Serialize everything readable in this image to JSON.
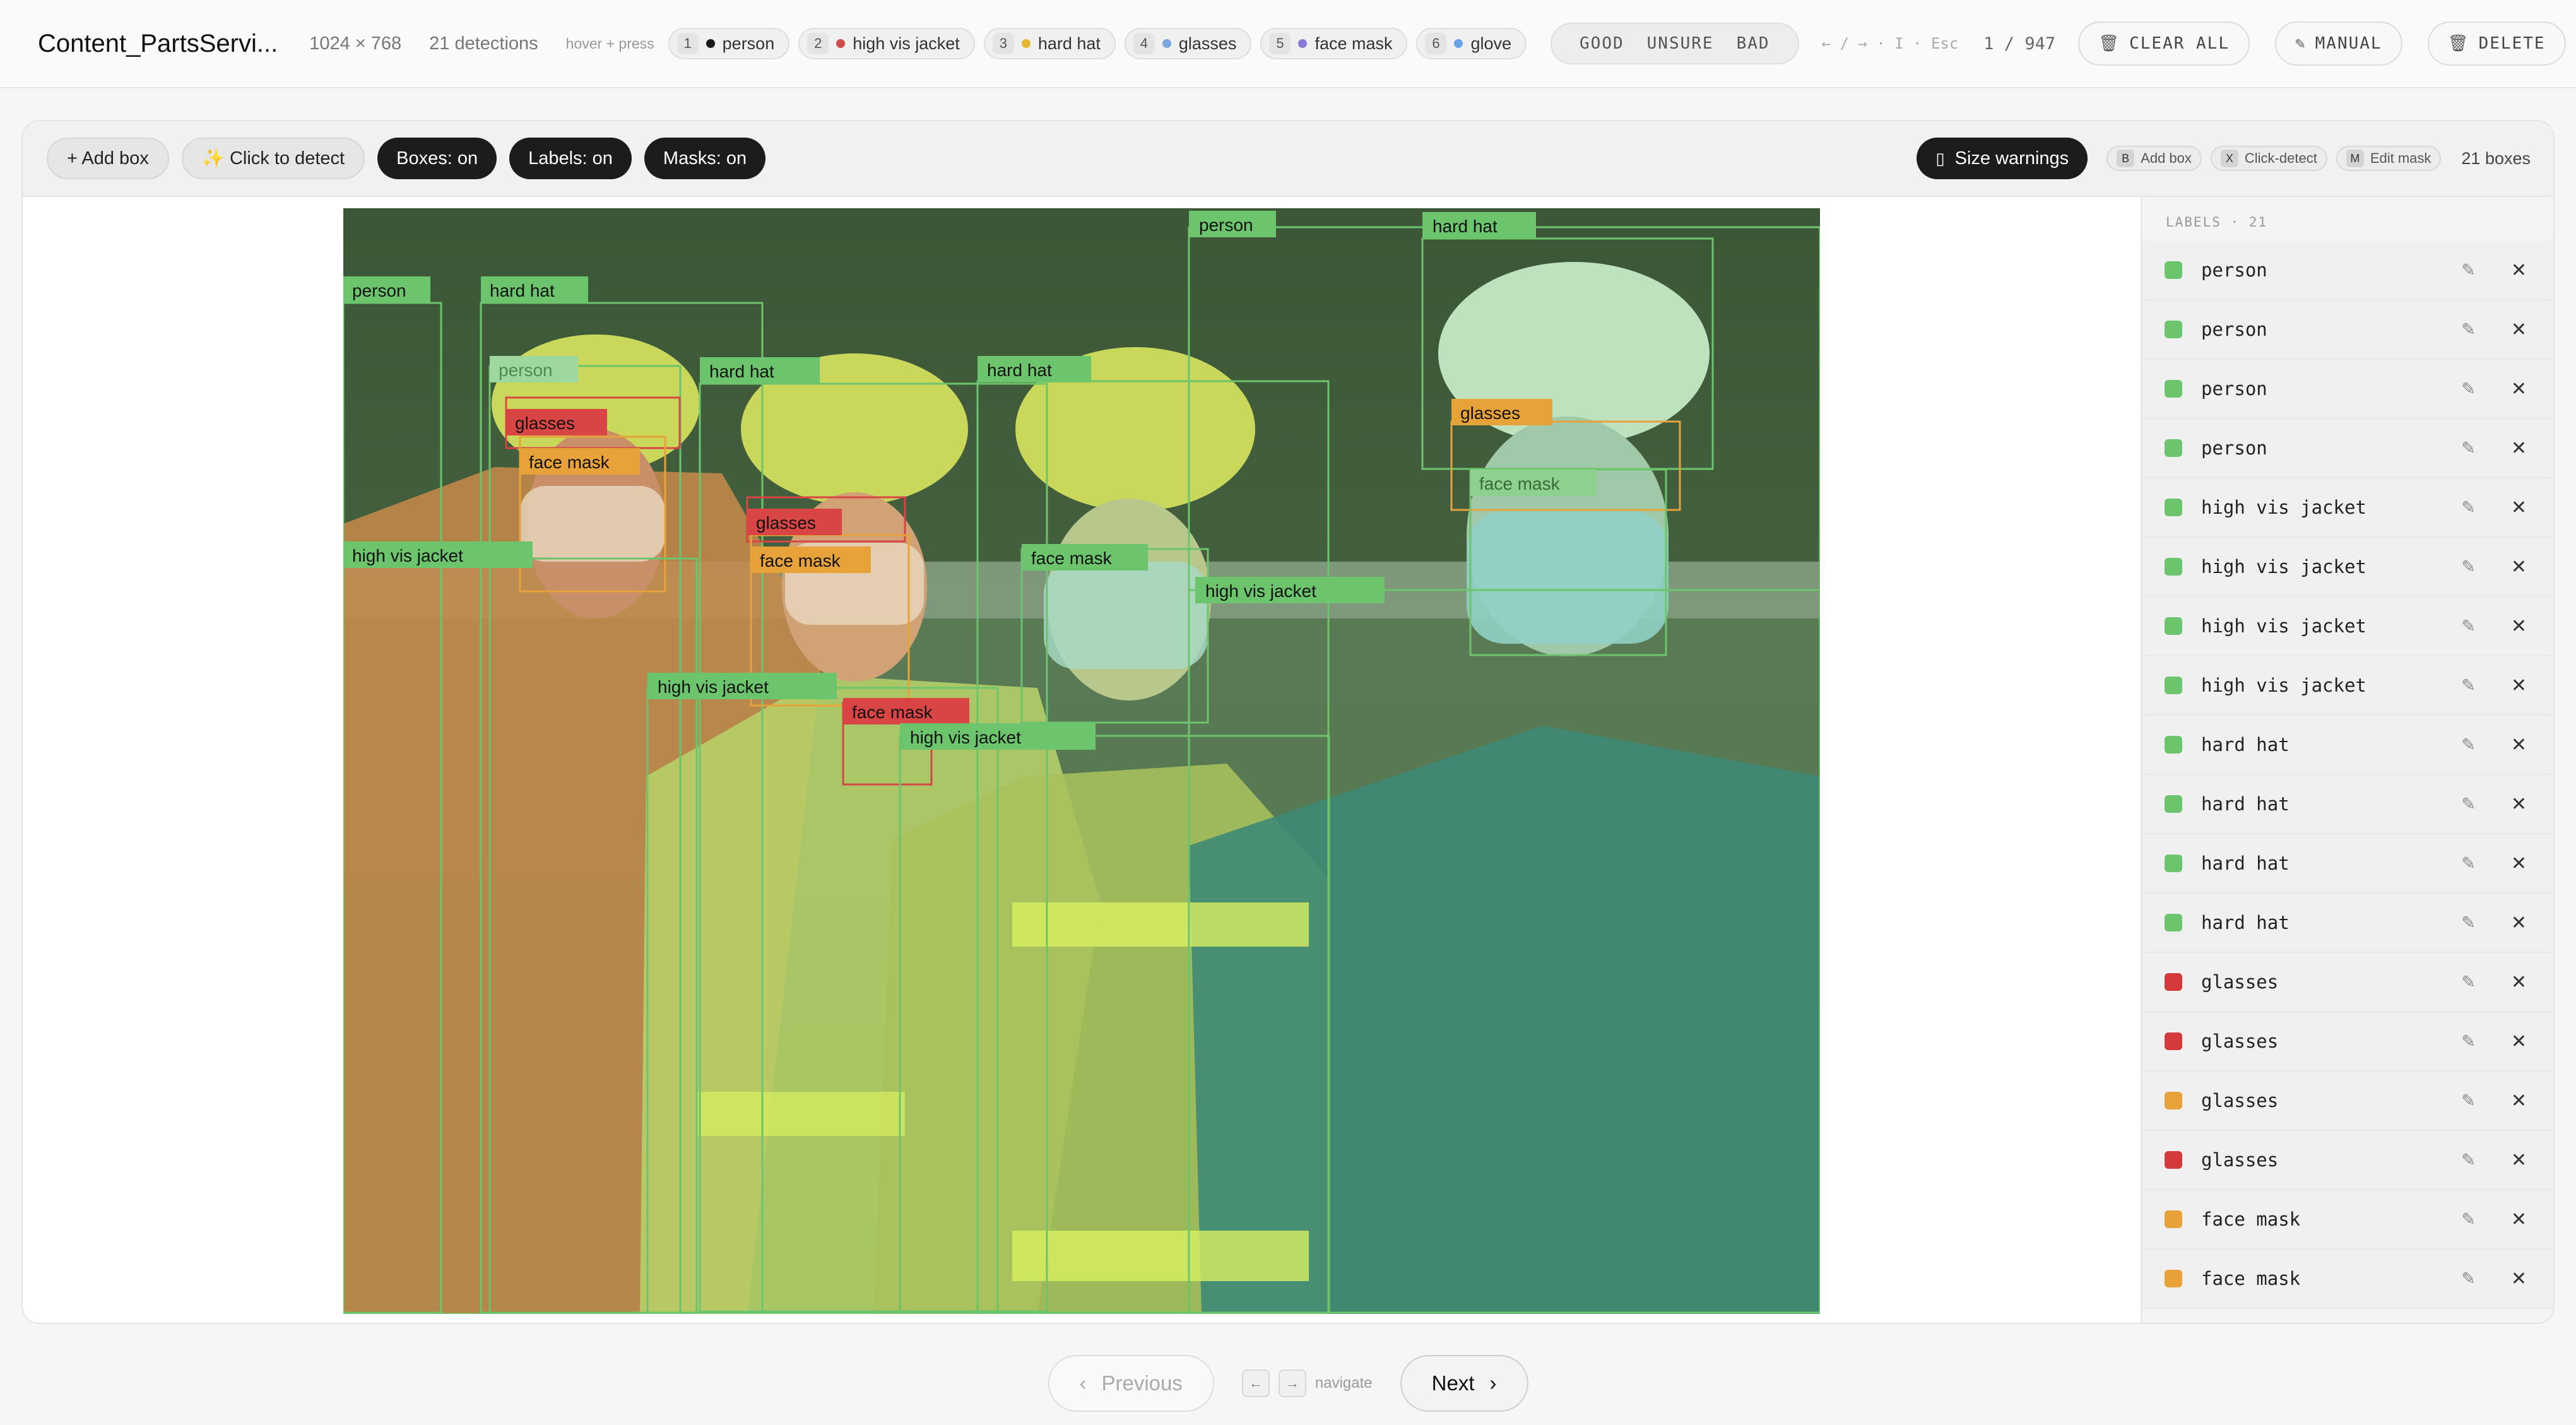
{
  "header": {
    "title": "Content_PartsServi...",
    "dimensions": "1024 × 768",
    "detections": "21 detections",
    "hint": "hover + press",
    "classes": [
      {
        "key": "1",
        "name": "person",
        "color": "#1a1a1a"
      },
      {
        "key": "2",
        "name": "high vis jacket",
        "color": "#d24b4b"
      },
      {
        "key": "3",
        "name": "hard hat",
        "color": "#e6b832"
      },
      {
        "key": "4",
        "name": "glasses",
        "color": "#7aa6e0"
      },
      {
        "key": "5",
        "name": "face mask",
        "color": "#8b7bd6"
      },
      {
        "key": "6",
        "name": "glove",
        "color": "#6aa2e8"
      }
    ],
    "rating": [
      "GOOD",
      "UNSURE",
      "BAD"
    ],
    "nav_hint": "← / → · I · Esc",
    "counter": "1 / 947",
    "clear_all": "CLEAR ALL",
    "manual": "MANUAL",
    "delete": "DELETE"
  },
  "toolbar": {
    "add_box": "+ Add box",
    "click_detect": "✨ Click to detect",
    "boxes": "Boxes: on",
    "labels": "Labels: on",
    "masks": "Masks: on",
    "size_warnings": "Size warnings",
    "shortcuts": [
      {
        "key": "B",
        "label": "Add box"
      },
      {
        "key": "X",
        "label": "Click-detect"
      },
      {
        "key": "M",
        "label": "Edit mask"
      }
    ],
    "box_count": "21 boxes"
  },
  "colors": {
    "green": "#6cc46c",
    "red": "#d94444",
    "orange": "#e8a23a"
  },
  "annotations": [
    {
      "label": "person",
      "color": "green"
    },
    {
      "label": "hard hat",
      "color": "green"
    },
    {
      "label": "person",
      "color": "green"
    },
    {
      "label": "glasses",
      "color": "red"
    },
    {
      "label": "face mask",
      "color": "orange"
    },
    {
      "label": "high vis jacket",
      "color": "green"
    },
    {
      "label": "hard hat",
      "color": "green"
    },
    {
      "label": "glasses",
      "color": "red"
    },
    {
      "label": "face mask",
      "color": "orange"
    },
    {
      "label": "high vis jacket",
      "color": "green"
    },
    {
      "label": "face mask",
      "color": "red"
    },
    {
      "label": "high vis jacket",
      "color": "green"
    },
    {
      "label": "hard hat",
      "color": "green"
    },
    {
      "label": "face mask",
      "color": "green"
    },
    {
      "label": "person",
      "color": "green"
    },
    {
      "label": "high vis jacket",
      "color": "green"
    },
    {
      "label": "hard hat",
      "color": "green"
    },
    {
      "label": "glasses",
      "color": "orange"
    },
    {
      "label": "face mask",
      "color": "green"
    }
  ],
  "sidebar": {
    "heading": "LABELS · 21",
    "items": [
      {
        "label": "person",
        "color": "#6cc46c"
      },
      {
        "label": "person",
        "color": "#6cc46c"
      },
      {
        "label": "person",
        "color": "#6cc46c"
      },
      {
        "label": "person",
        "color": "#6cc46c"
      },
      {
        "label": "high vis jacket",
        "color": "#6cc46c"
      },
      {
        "label": "high vis jacket",
        "color": "#6cc46c"
      },
      {
        "label": "high vis jacket",
        "color": "#6cc46c"
      },
      {
        "label": "high vis jacket",
        "color": "#6cc46c"
      },
      {
        "label": "hard hat",
        "color": "#6cc46c"
      },
      {
        "label": "hard hat",
        "color": "#6cc46c"
      },
      {
        "label": "hard hat",
        "color": "#6cc46c"
      },
      {
        "label": "hard hat",
        "color": "#6cc46c"
      },
      {
        "label": "glasses",
        "color": "#d33b3b"
      },
      {
        "label": "glasses",
        "color": "#d33b3b"
      },
      {
        "label": "glasses",
        "color": "#e8a23a"
      },
      {
        "label": "glasses",
        "color": "#d33b3b"
      },
      {
        "label": "face mask",
        "color": "#e8a23a"
      },
      {
        "label": "face mask",
        "color": "#e8a23a"
      }
    ]
  },
  "footer": {
    "previous": "Previous",
    "navigate": "navigate",
    "next": "Next"
  }
}
